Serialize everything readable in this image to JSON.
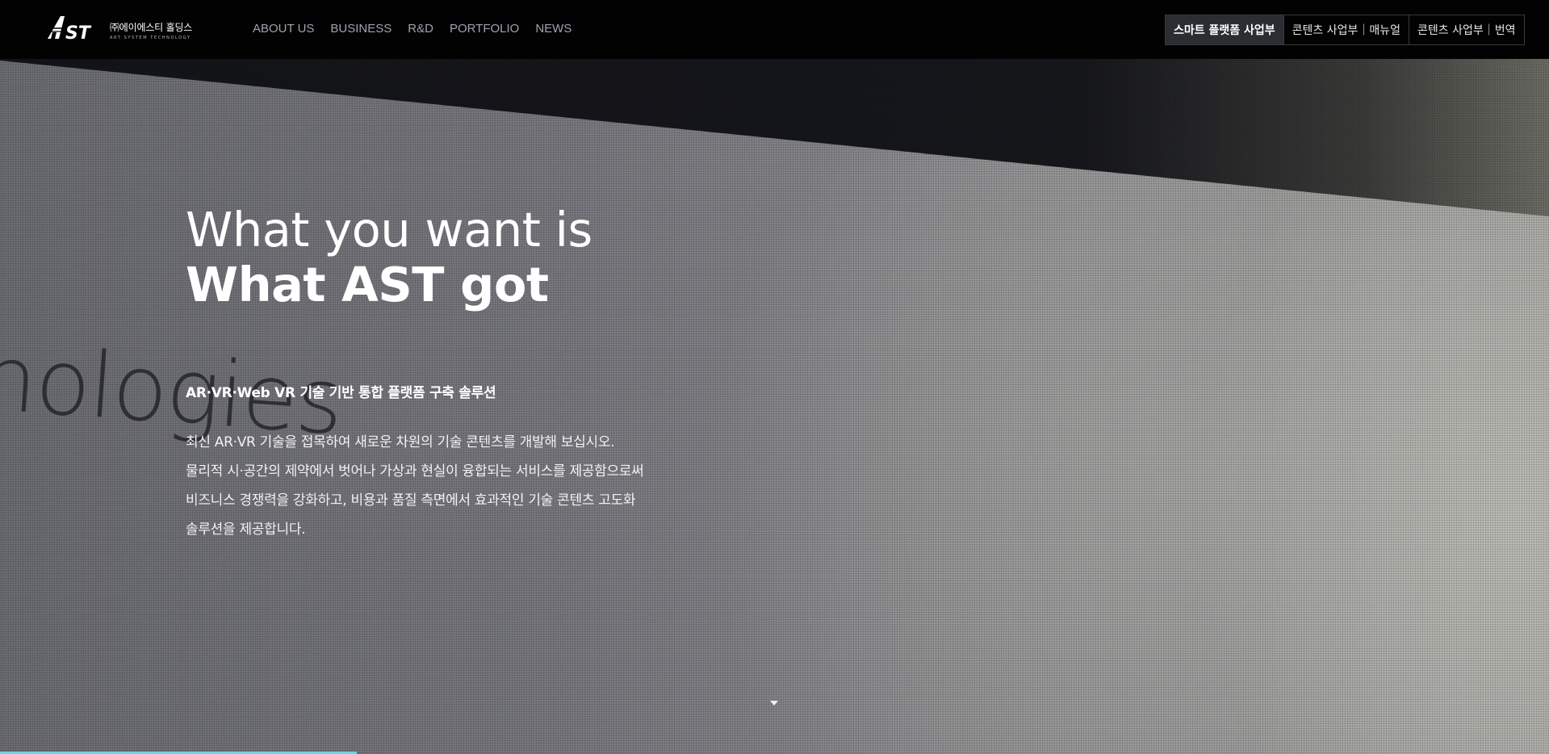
{
  "header": {
    "logo_mark": "AST",
    "logo_korean": "㈜에이에스티 홀딩스",
    "logo_sub": "ART SYSTEM TECHNOLOGY",
    "nav": [
      "ABOUT US",
      "BUSINESS",
      "R&D",
      "PORTFOLIO",
      "NEWS"
    ],
    "biz_buttons": [
      {
        "label": "스마트 플랫폼 사업부",
        "active": true
      },
      {
        "label": "콘텐츠 사업부｜매뉴얼",
        "active": false
      },
      {
        "label": "콘텐츠 사업부｜번역",
        "active": false
      }
    ]
  },
  "hero": {
    "bg_word": "nologies",
    "headline_line1": "What you want is",
    "headline_line2": "What AST got",
    "sub_title": "AR·VR·Web VR 기술 기반 통합 플랫폼 구축 솔루션",
    "description": [
      "최신 AR·VR 기술을 접목하여 새로운 차원의 기술 콘텐츠를 개발해 보십시오.",
      "물리적 시·공간의 제약에서 벗어나 가상과 현실이 융합되는 서비스를 제공함으로써",
      "비즈니스 경쟁력을 강화하고, 비용과 품질 측면에서 효과적인 기술 콘텐츠 고도화",
      "솔루션을 제공합니다."
    ],
    "scroll_icon": "caret-down-icon"
  },
  "colors": {
    "header_bg": "#020203",
    "nav_text": "#9fa3ad",
    "active_button_bg": "#2b2d33",
    "progress_bar": "#6fd3e8"
  }
}
